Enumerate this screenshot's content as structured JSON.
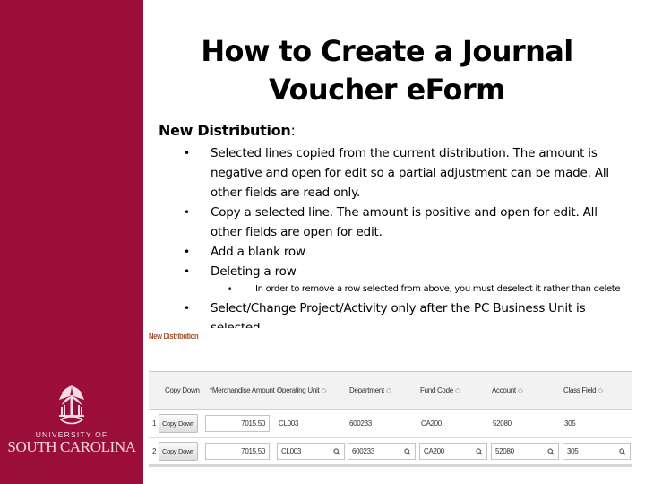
{
  "slide": {
    "title": "How to Create a Journal Voucher eForm",
    "section_heading": "New Distribution",
    "section_colon": ":",
    "bullets": [
      "Selected lines copied from the current distribution.  The amount is negative and open for edit so a partial adjustment can be made.  All other fields are read only.",
      "Copy a selected line.  The amount is positive and open for edit.  All other fields are open for edit.",
      "Add a blank row",
      "Deleting a row"
    ],
    "sub_bullet": "In order to remove a row selected from above, you must deselect it rather than delete",
    "last_bullet": "Select/Change Project/Activity only after the PC Business Unit is selected",
    "bullet_glyph": "•"
  },
  "branding": {
    "line1": "UNIVERSITY OF",
    "line2": "SOUTH CAROLINA",
    "sidebar_color": "#9b0e3b"
  },
  "screenshot": {
    "label": "New Distribution",
    "sort_icon": "◇",
    "columns": [
      "Copy Down",
      "*Merchandise Amount",
      "Operating Unit",
      "Department",
      "Fund Code",
      "Account",
      "Class Field"
    ],
    "rows": [
      {
        "num": "1",
        "button": "Copy Down",
        "amount": "7015.50",
        "operating_unit": "CL003",
        "department": "600233",
        "fund_code": "CA200",
        "account": "52080",
        "class_field": "305"
      },
      {
        "num": "2",
        "button": "Copy Down",
        "amount": "7015.50",
        "operating_unit": "CL003",
        "department": "600233",
        "fund_code": "CA200",
        "account": "52080",
        "class_field": "305"
      }
    ]
  }
}
